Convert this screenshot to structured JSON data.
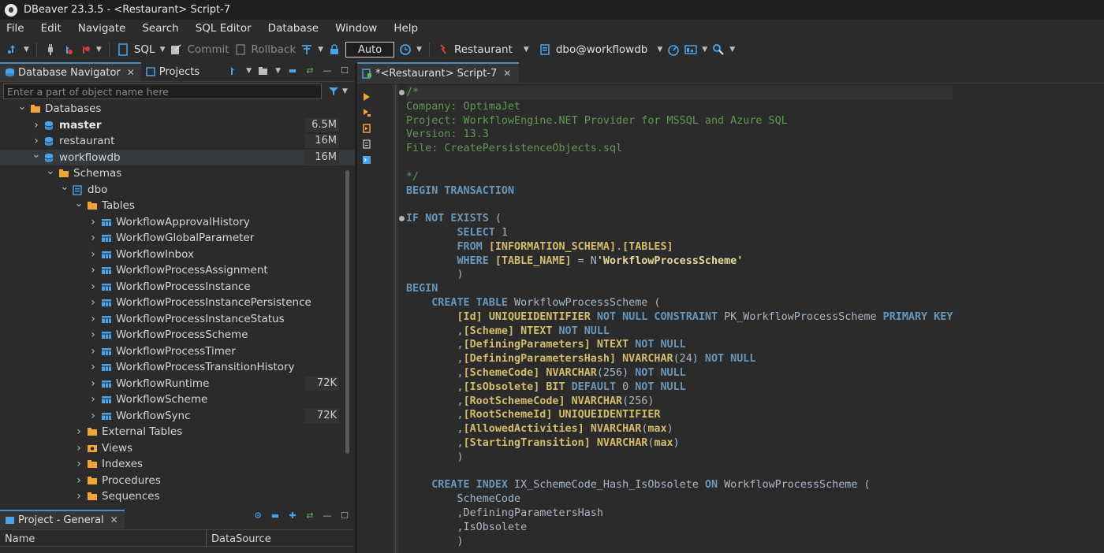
{
  "window": {
    "title": "DBeaver 23.3.5 - <Restaurant> Script-7"
  },
  "menu": [
    "File",
    "Edit",
    "Navigate",
    "Search",
    "SQL Editor",
    "Database",
    "Window",
    "Help"
  ],
  "toolbar": {
    "sql_label": "SQL",
    "commit_label": "Commit",
    "rollback_label": "Rollback",
    "auto_label": "Auto",
    "connection_label": "Restaurant",
    "schema_label": "dbo@workflowdb"
  },
  "navigator": {
    "tab_label": "Database Navigator",
    "projects_tab_label": "Projects",
    "filter_placeholder": "Enter a part of object name here",
    "tree": [
      {
        "label": "Databases",
        "level": 1,
        "icon": "folder",
        "chevron": "down"
      },
      {
        "label": "master",
        "level": 2,
        "icon": "database",
        "chevron": "right",
        "size": "6.5M",
        "bold": true
      },
      {
        "label": "restaurant",
        "level": 2,
        "icon": "database",
        "chevron": "right",
        "size": "16M"
      },
      {
        "label": "workflowdb",
        "level": 2,
        "icon": "database",
        "chevron": "down",
        "size": "16M",
        "selected": true
      },
      {
        "label": "Schemas",
        "level": 3,
        "icon": "folder",
        "chevron": "down"
      },
      {
        "label": "dbo",
        "level": 4,
        "icon": "schema",
        "chevron": "down"
      },
      {
        "label": "Tables",
        "level": 5,
        "icon": "folder",
        "chevron": "down"
      },
      {
        "label": "WorkflowApprovalHistory",
        "level": 6,
        "icon": "table",
        "chevron": "right"
      },
      {
        "label": "WorkflowGlobalParameter",
        "level": 6,
        "icon": "table",
        "chevron": "right"
      },
      {
        "label": "WorkflowInbox",
        "level": 6,
        "icon": "table",
        "chevron": "right"
      },
      {
        "label": "WorkflowProcessAssignment",
        "level": 6,
        "icon": "table",
        "chevron": "right"
      },
      {
        "label": "WorkflowProcessInstance",
        "level": 6,
        "icon": "table",
        "chevron": "right"
      },
      {
        "label": "WorkflowProcessInstancePersistence",
        "level": 6,
        "icon": "table",
        "chevron": "right"
      },
      {
        "label": "WorkflowProcessInstanceStatus",
        "level": 6,
        "icon": "table",
        "chevron": "right"
      },
      {
        "label": "WorkflowProcessScheme",
        "level": 6,
        "icon": "table",
        "chevron": "right"
      },
      {
        "label": "WorkflowProcessTimer",
        "level": 6,
        "icon": "table",
        "chevron": "right"
      },
      {
        "label": "WorkflowProcessTransitionHistory",
        "level": 6,
        "icon": "table",
        "chevron": "right"
      },
      {
        "label": "WorkflowRuntime",
        "level": 6,
        "icon": "table",
        "chevron": "right",
        "size": "72K"
      },
      {
        "label": "WorkflowScheme",
        "level": 6,
        "icon": "table",
        "chevron": "right"
      },
      {
        "label": "WorkflowSync",
        "level": 6,
        "icon": "table",
        "chevron": "right",
        "size": "72K"
      },
      {
        "label": "External Tables",
        "level": 5,
        "icon": "folder",
        "chevron": "right"
      },
      {
        "label": "Views",
        "level": 5,
        "icon": "view",
        "chevron": "right"
      },
      {
        "label": "Indexes",
        "level": 5,
        "icon": "folder",
        "chevron": "right"
      },
      {
        "label": "Procedures",
        "level": 5,
        "icon": "folder",
        "chevron": "right"
      },
      {
        "label": "Sequences",
        "level": 5,
        "icon": "folder",
        "chevron": "right"
      }
    ]
  },
  "project_panel": {
    "tab_label": "Project - General",
    "columns": [
      "Name",
      "DataSource"
    ]
  },
  "editor": {
    "tab_label": "*<Restaurant> Script-7",
    "lines": [
      [
        [
          "cm",
          "/*"
        ]
      ],
      [
        [
          "cm",
          "Company: OptimaJet"
        ]
      ],
      [
        [
          "cm",
          "Project: WorkflowEngine.NET Provider for MSSQL and Azure SQL"
        ]
      ],
      [
        [
          "cm",
          "Version: 13.3"
        ]
      ],
      [
        [
          "cm",
          "File: CreatePersistenceObjects.sql"
        ]
      ],
      [
        [
          "cm",
          ""
        ]
      ],
      [
        [
          "cm",
          "*/"
        ]
      ],
      [
        [
          "kw",
          "BEGIN TRANSACTION"
        ]
      ],
      [
        [
          "plain",
          ""
        ]
      ],
      [
        [
          "kw",
          "IF NOT EXISTS"
        ],
        [
          "plain",
          " ("
        ]
      ],
      [
        [
          "plain",
          "        "
        ],
        [
          "kw",
          "SELECT"
        ],
        [
          "plain",
          " 1"
        ]
      ],
      [
        [
          "plain",
          "        "
        ],
        [
          "kw",
          "FROM"
        ],
        [
          "plain",
          " "
        ],
        [
          "ident",
          "[INFORMATION_SCHEMA]"
        ],
        [
          "plain",
          "."
        ],
        [
          "ident",
          "[TABLES]"
        ]
      ],
      [
        [
          "plain",
          "        "
        ],
        [
          "kw",
          "WHERE"
        ],
        [
          "plain",
          " "
        ],
        [
          "ident",
          "[TABLE_NAME]"
        ],
        [
          "plain",
          " = N"
        ],
        [
          "str",
          "'WorkflowProcessScheme'"
        ]
      ],
      [
        [
          "plain",
          "        )"
        ]
      ],
      [
        [
          "kw",
          "BEGIN"
        ]
      ],
      [
        [
          "plain",
          "    "
        ],
        [
          "kw",
          "CREATE TABLE"
        ],
        [
          "plain",
          " WorkflowProcessScheme ("
        ]
      ],
      [
        [
          "plain",
          "        "
        ],
        [
          "ident",
          "[Id]"
        ],
        [
          "plain",
          " "
        ],
        [
          "ident",
          "UNIQUEIDENTIFIER"
        ],
        [
          "plain",
          " "
        ],
        [
          "kw",
          "NOT NULL CONSTRAINT"
        ],
        [
          "plain",
          " PK_WorkflowProcessScheme "
        ],
        [
          "kw",
          "PRIMARY KEY"
        ]
      ],
      [
        [
          "plain",
          "        ,"
        ],
        [
          "ident",
          "[Scheme]"
        ],
        [
          "plain",
          " "
        ],
        [
          "ident",
          "NTEXT"
        ],
        [
          "plain",
          " "
        ],
        [
          "kw",
          "NOT NULL"
        ]
      ],
      [
        [
          "plain",
          "        ,"
        ],
        [
          "ident",
          "[DefiningParameters]"
        ],
        [
          "plain",
          " "
        ],
        [
          "ident",
          "NTEXT"
        ],
        [
          "plain",
          " "
        ],
        [
          "kw",
          "NOT NULL"
        ]
      ],
      [
        [
          "plain",
          "        ,"
        ],
        [
          "ident",
          "[DefiningParametersHash]"
        ],
        [
          "plain",
          " "
        ],
        [
          "ident",
          "NVARCHAR"
        ],
        [
          "plain",
          "(24) "
        ],
        [
          "kw",
          "NOT NULL"
        ]
      ],
      [
        [
          "plain",
          "        ,"
        ],
        [
          "ident",
          "[SchemeCode]"
        ],
        [
          "plain",
          " "
        ],
        [
          "ident",
          "NVARCHAR"
        ],
        [
          "plain",
          "(256) "
        ],
        [
          "kw",
          "NOT NULL"
        ]
      ],
      [
        [
          "plain",
          "        ,"
        ],
        [
          "ident",
          "[IsObsolete]"
        ],
        [
          "plain",
          " "
        ],
        [
          "ident",
          "BIT"
        ],
        [
          "plain",
          " "
        ],
        [
          "kw",
          "DEFAULT"
        ],
        [
          "plain",
          " 0 "
        ],
        [
          "kw",
          "NOT NULL"
        ]
      ],
      [
        [
          "plain",
          "        ,"
        ],
        [
          "ident",
          "[RootSchemeCode]"
        ],
        [
          "plain",
          " "
        ],
        [
          "ident",
          "NVARCHAR"
        ],
        [
          "plain",
          "(256)"
        ]
      ],
      [
        [
          "plain",
          "        ,"
        ],
        [
          "ident",
          "[RootSchemeId]"
        ],
        [
          "plain",
          " "
        ],
        [
          "ident",
          "UNIQUEIDENTIFIER"
        ]
      ],
      [
        [
          "plain",
          "        ,"
        ],
        [
          "ident",
          "[AllowedActivities]"
        ],
        [
          "plain",
          " "
        ],
        [
          "ident",
          "NVARCHAR"
        ],
        [
          "plain",
          "("
        ],
        [
          "ident",
          "max"
        ],
        [
          "plain",
          ")"
        ]
      ],
      [
        [
          "plain",
          "        ,"
        ],
        [
          "ident",
          "[StartingTransition]"
        ],
        [
          "plain",
          " "
        ],
        [
          "ident",
          "NVARCHAR"
        ],
        [
          "plain",
          "("
        ],
        [
          "ident",
          "max"
        ],
        [
          "plain",
          ")"
        ]
      ],
      [
        [
          "plain",
          "        )"
        ]
      ],
      [
        [
          "plain",
          ""
        ]
      ],
      [
        [
          "plain",
          "    "
        ],
        [
          "kw",
          "CREATE INDEX"
        ],
        [
          "plain",
          " IX_SchemeCode_Hash_IsObsolete "
        ],
        [
          "kw",
          "ON"
        ],
        [
          "plain",
          " WorkflowProcessScheme ("
        ]
      ],
      [
        [
          "plain",
          "        SchemeCode"
        ]
      ],
      [
        [
          "plain",
          "        ,DefiningParametersHash"
        ]
      ],
      [
        [
          "plain",
          "        ,IsObsolete"
        ]
      ],
      [
        [
          "plain",
          "        )"
        ]
      ]
    ]
  },
  "colors": {
    "accent": "#4a88c7",
    "comment": "#629755",
    "keyword": "#6897bb",
    "identifier": "#d4bd6a",
    "string": "#e8d79a",
    "db_icon": "#4aa3e8",
    "folder_icon": "#f0a43a"
  }
}
